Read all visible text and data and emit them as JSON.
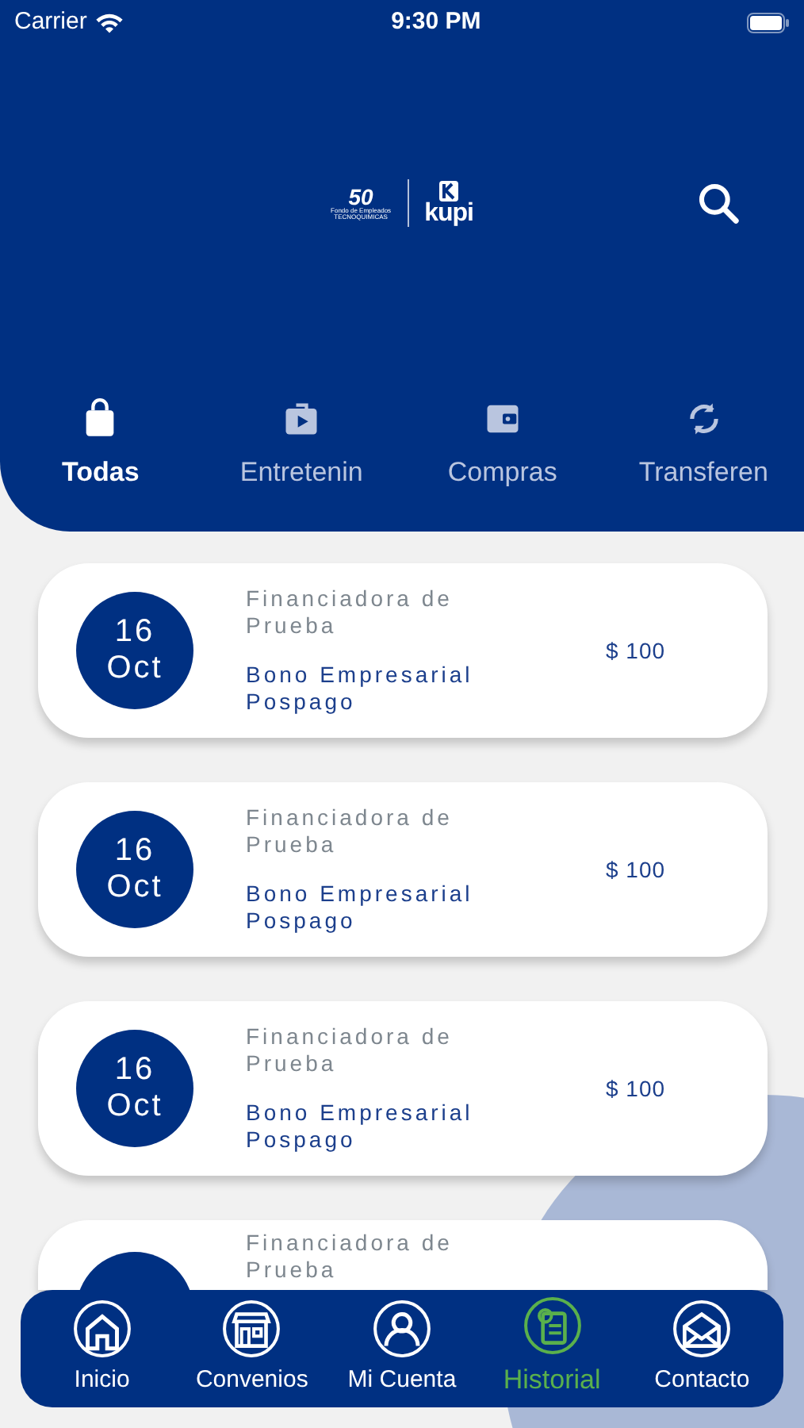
{
  "status_bar": {
    "carrier": "Carrier",
    "time": "9:30 PM"
  },
  "header": {
    "logo": {
      "anniversary": "50",
      "org": "Fondo de Empleados",
      "company": "TECNOQUIMICAS",
      "brand": "kupi"
    }
  },
  "tabs": [
    {
      "label": "Todas",
      "selected": true
    },
    {
      "label": "Entretenin",
      "selected": false
    },
    {
      "label": "Compras",
      "selected": false
    },
    {
      "label": "Transferen",
      "selected": false
    }
  ],
  "transactions": [
    {
      "day": "16",
      "month": "Oct",
      "company": "Financiadora de Prueba",
      "product": "Bono Empresarial Pospago",
      "amount": "$ 100"
    },
    {
      "day": "16",
      "month": "Oct",
      "company": "Financiadora de Prueba",
      "product": "Bono Empresarial Pospago",
      "amount": "$ 100"
    },
    {
      "day": "16",
      "month": "Oct",
      "company": "Financiadora de Prueba",
      "product": "Bono Empresarial Pospago",
      "amount": "$ 100"
    },
    {
      "company": "Financiadora de Prueba"
    }
  ],
  "bottom_nav": [
    {
      "label": "Inicio",
      "selected": false
    },
    {
      "label": "Convenios",
      "selected": false
    },
    {
      "label": "Mi Cuenta",
      "selected": false
    },
    {
      "label": "Historial",
      "selected": true
    },
    {
      "label": "Contacto",
      "selected": false
    }
  ]
}
